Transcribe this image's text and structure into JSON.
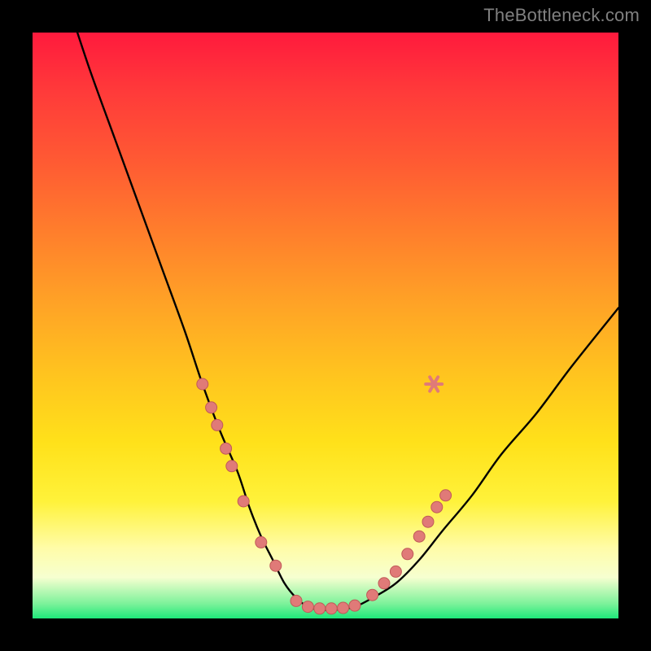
{
  "watermark": "TheBottleneck.com",
  "chart_data": {
    "type": "line",
    "title": "",
    "xlabel": "",
    "ylabel": "",
    "xlim": [
      0,
      100
    ],
    "ylim": [
      0,
      100
    ],
    "grid": false,
    "series": [
      {
        "name": "bottleneck-curve",
        "x": [
          7,
          10,
          14,
          18,
          22,
          26,
          29,
          32,
          35,
          37,
          39,
          41,
          43,
          45,
          47,
          49,
          52,
          55,
          58,
          62,
          66,
          70,
          75,
          80,
          86,
          92,
          100
        ],
        "y": [
          102,
          93,
          82,
          71,
          60,
          49,
          40,
          32,
          25,
          19,
          14,
          10,
          6,
          3.5,
          2,
          1.5,
          1.5,
          2,
          3.5,
          6,
          10,
          15,
          21,
          28,
          35,
          43,
          53
        ]
      }
    ],
    "markers": [
      {
        "name": "left-cluster",
        "points": [
          {
            "x": 29,
            "y": 40
          },
          {
            "x": 30.5,
            "y": 36
          },
          {
            "x": 31.5,
            "y": 33
          },
          {
            "x": 33,
            "y": 29
          },
          {
            "x": 34,
            "y": 26
          },
          {
            "x": 36,
            "y": 20
          },
          {
            "x": 39,
            "y": 13
          },
          {
            "x": 41.5,
            "y": 9
          }
        ]
      },
      {
        "name": "bottom-cluster",
        "points": [
          {
            "x": 45,
            "y": 3
          },
          {
            "x": 47,
            "y": 2
          },
          {
            "x": 49,
            "y": 1.7
          },
          {
            "x": 51,
            "y": 1.7
          },
          {
            "x": 53,
            "y": 1.8
          },
          {
            "x": 55,
            "y": 2.2
          }
        ]
      },
      {
        "name": "right-cluster",
        "points": [
          {
            "x": 58,
            "y": 4
          },
          {
            "x": 60,
            "y": 6
          },
          {
            "x": 62,
            "y": 8
          },
          {
            "x": 64,
            "y": 11
          },
          {
            "x": 66,
            "y": 14
          },
          {
            "x": 67.5,
            "y": 16.5
          },
          {
            "x": 69,
            "y": 19
          },
          {
            "x": 70.5,
            "y": 21
          }
        ]
      },
      {
        "name": "right-star",
        "style": "star",
        "points": [
          {
            "x": 68.5,
            "y": 40
          }
        ]
      }
    ],
    "colors": {
      "curve": "#000000",
      "marker_fill": "#e07a78",
      "marker_stroke": "#c05a58",
      "gradient_top": "#ff1a3d",
      "gradient_mid": "#ffe11a",
      "gradient_bottom": "#1ee87a"
    }
  }
}
